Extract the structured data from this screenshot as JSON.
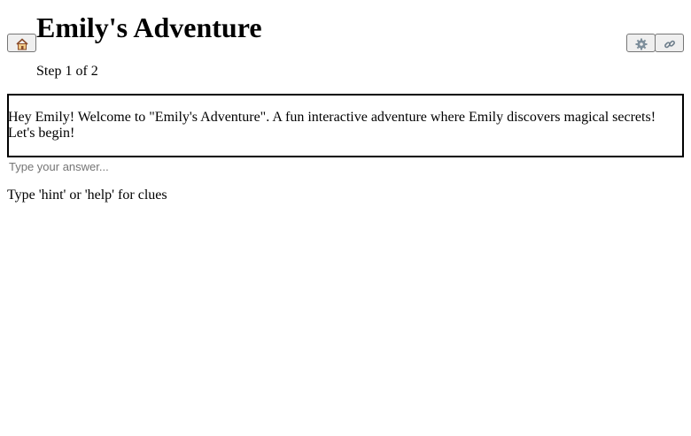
{
  "header": {
    "title": "Emily's Adventure",
    "step_text": "Step 1 of 2"
  },
  "buttons": {
    "home_icon": "house-emoji",
    "settings_icon": "gear-emoji",
    "share_icon": "link-emoji"
  },
  "story": {
    "text": "Hey Emily! Welcome to \"Emily's Adventure\". A fun interactive adventure where Emily discovers magical secrets! Let's begin!"
  },
  "answer": {
    "value": "",
    "placeholder": "Type your answer..."
  },
  "hint_text": "Type 'hint' or 'help' for clues"
}
